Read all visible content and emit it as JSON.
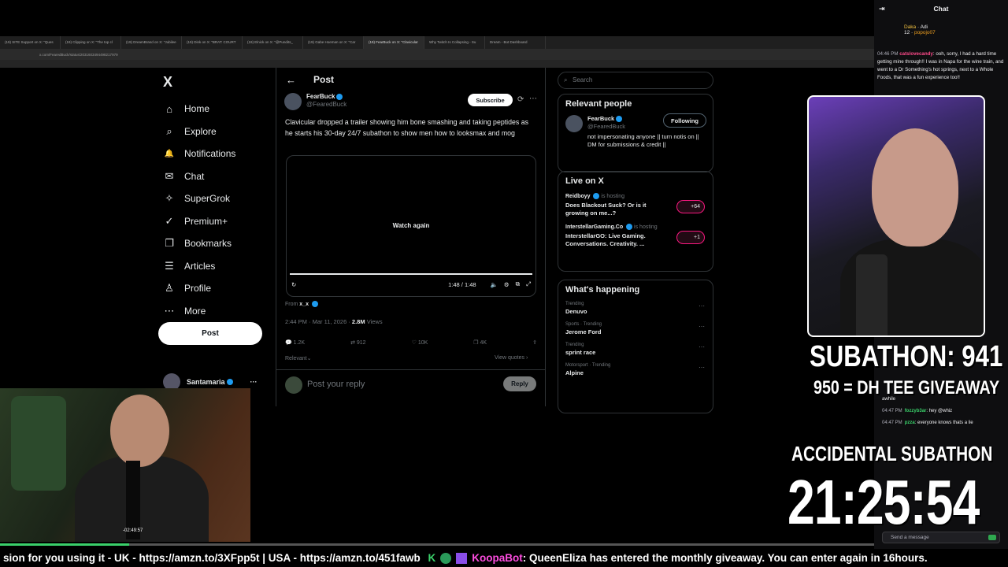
{
  "browser": {
    "tabs": [
      "(19) SITE Support on X: \"Ques",
      "(19) Clipping on X: \"The top cl",
      "(19) DreamBrand on X: \"Jubilee",
      "(19) Dink on X: \"BRAT: COURT",
      "(19) Elnick on X: \"@Pundits_",
      "(19) Gabe Hoeman on X: \"Car",
      "(19) FearBuck on X: \"Clavicular",
      "Why Twitch Is Collapsing - Su",
      "Dream - Bot Dashboard"
    ],
    "url": "x.com/FearedBuck/status/2031603494498217979"
  },
  "x_nav": {
    "logo": "X",
    "items": [
      {
        "label": "Home",
        "icon": "⌂"
      },
      {
        "label": "Explore",
        "icon": "⌕"
      },
      {
        "label": "Notifications",
        "icon": "🔔"
      },
      {
        "label": "Chat",
        "icon": "✉"
      },
      {
        "label": "SuperGrok",
        "icon": "✧"
      },
      {
        "label": "Premium+",
        "icon": "✓"
      },
      {
        "label": "Bookmarks",
        "icon": "❐"
      },
      {
        "label": "Articles",
        "icon": "☰"
      },
      {
        "label": "Profile",
        "icon": "♙"
      },
      {
        "label": "More",
        "icon": "⋯"
      }
    ],
    "post_button": "Post",
    "account_name": "Santamaria",
    "account_more": "···"
  },
  "post": {
    "header": "Post",
    "back_icon": "←",
    "author_name": "FearBuck",
    "author_handle": "@FearedBuck",
    "subscribe_label": "Subscribe",
    "text": "Clavicular dropped a trailer showing him bone smashing and taking peptides as he starts his 30-day 24/7 subathon to show men how to looksmax and mog",
    "watch_again": "Watch again",
    "video_time": "1:48 / 1:48",
    "from_prefix": "From",
    "from_name": "x_x",
    "timestamp": "2:44 PM · Mar 11, 2026 ·",
    "views_count": "2.8M",
    "views_label": "Views",
    "replies": "1.2K",
    "reposts": "912",
    "likes": "10K",
    "bookmarks": "4K",
    "relevant_label": "Relevant",
    "view_quotes": "View quotes",
    "reply_placeholder": "Post your reply",
    "reply_button": "Reply"
  },
  "sidebar_right": {
    "search_placeholder": "Search",
    "relevant_title": "Relevant people",
    "rp_name": "FearBuck",
    "rp_handle": "@FearedBuck",
    "rp_bio": "not impersonating anyone || turn notis on || DM for submissions & credit ||",
    "following_label": "Following",
    "live_title": "Live on X",
    "live": [
      {
        "host": "Reidboyy",
        "suffix": "is hosting",
        "title": "Does Blackout Suck? Or is it growing on me...?",
        "badge": "+64"
      },
      {
        "host": "InterstellarGaming.Co",
        "suffix": "is hosting",
        "title": "InterstellarGO: Live Gaming. Conversations. Creativity. ...",
        "badge": "+1"
      }
    ],
    "happening_title": "What's happening",
    "trends": [
      {
        "cat": "Trending",
        "title": "Denuvo"
      },
      {
        "cat": "Sports · Trending",
        "title": "Jerome Ford"
      },
      {
        "cat": "Trending",
        "title": "sprint race"
      },
      {
        "cat": "Motorsport · Trending",
        "title": "Alpine"
      }
    ]
  },
  "chat": {
    "title": "Chat",
    "gifter1": "Daka",
    "gifter1_count": "12",
    "gifter2": "Adi",
    "gifter3": "popojo07",
    "top_msg_time": "04:46 PM",
    "top_msg_user": "catslovecandy",
    "top_msg_text": "ooh, sorry, I had a hard time getting mine through!! I was in Napa for the wine train, and went to a Dr Something's hot springs, next to a Whole Foods, that was a fun experience too!!",
    "lower_msgs": [
      {
        "time": "",
        "user": "",
        "text": "awhile"
      },
      {
        "time": "04:47 PM",
        "user": "fozzyb3ar",
        "text": "hey @whiz"
      },
      {
        "time": "04:47 PM",
        "user": "pzza",
        "text": "everyone knows thats a lie"
      }
    ],
    "send_placeholder": "Send a message"
  },
  "overlay": {
    "subathon": "SUBATHON: 941",
    "giveaway": "950 = DH TEE GIVEAWAY",
    "accidental": "ACCIDENTAL SUBATHON",
    "timer": "21:25:54",
    "progress_time": "-02:49:57"
  },
  "progress": {
    "fraction": 0.148
  },
  "ticker": {
    "text1": "sion for you using it - UK - https://amzn.to/3XFpp5t | USA - https://amzn.to/451fawb",
    "bot": "KoopaBot",
    "text2": ": QueenEliza has entered the monthly giveaway. You can enter again in 16hours."
  }
}
